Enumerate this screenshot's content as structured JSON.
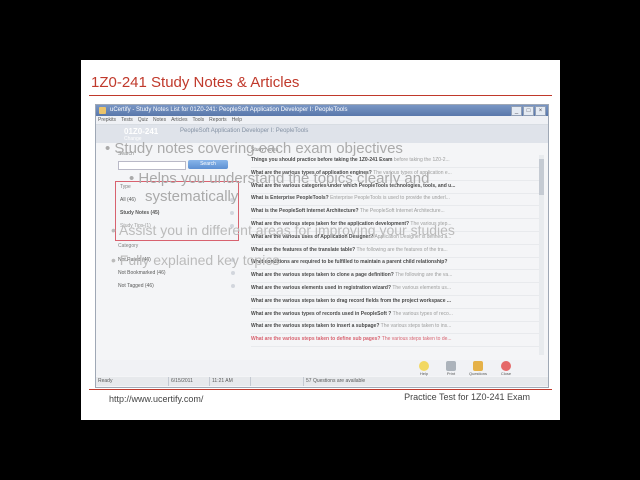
{
  "slide": {
    "title": "1Z0-241 Study Notes & Articles",
    "bullets": [
      "Study notes covering each exam objectives",
      "Helps you understand the topics clearly and",
      "systematically",
      "Assist you in different areas for improving your studies",
      "Fully explained key topics"
    ],
    "footer_url": "http://www.ucertify.com/",
    "footer_right": "Practice Test for 1Z0-241 Exam"
  },
  "window": {
    "title": "uCertify - Study Notes List for 01Z0-241: PeopleSoft Application Developer I: PeopleTools",
    "menu": [
      "Prepkits",
      "Tests",
      "Quiz",
      "Notes",
      "Articles",
      "Tools",
      "Reports",
      "Help"
    ],
    "exam_code": "01Z0-241",
    "exam_sub": "Change",
    "exam_name": "PeopleSoft Application Developer I: PeopleTools",
    "search_label": "Search",
    "search_button": "Search",
    "type_label": "Type",
    "types": [
      "All (46)",
      "Study Notes (45)",
      "Study Tips (1)"
    ],
    "category_label": "Category",
    "categories": [
      "Not Rated (46)",
      "Not Bookmarked (46)",
      "Not Tagged (46)"
    ],
    "notes_label": "Study Notes",
    "questions": [
      {
        "q": "Things you should practice before taking the 1Z0-241 Exam",
        "a": "before taking the 1Z0-2..."
      },
      {
        "q": "What are the various types of application engines?",
        "a": "The various types of application e..."
      },
      {
        "q": "What are the various categories under which PeopleTools technologies, tools, and u...",
        "a": ""
      },
      {
        "q": "What is Enterprise PeopleTools?",
        "a": "Enterprise PeopleTools is used to provide the underl..."
      },
      {
        "q": "What is the PeopleSoft Internet Architecture?",
        "a": "The PeopleSoft Internet Architecture..."
      },
      {
        "q": "What are the various steps taken for the application development?",
        "a": "The various step..."
      },
      {
        "q": "What are the various uses of Application Designer?",
        "a": "Application Designer is defined a..."
      },
      {
        "q": "What are the features of the translate table?",
        "a": "The following are the features of the tra..."
      },
      {
        "q": "What conditions are required to be fulfilled to maintain a parent child relationship?",
        "a": ""
      },
      {
        "q": "What are the various steps taken to clone a page definition?",
        "a": "The following are the va..."
      },
      {
        "q": "What are the various elements used in registration wizard?",
        "a": "The various elements us..."
      },
      {
        "q": "What are the various steps taken to drag record fields from the project workspace ...",
        "a": ""
      },
      {
        "q": "What are the various types of records used in PeopleSoft ?",
        "a": "The various types of reco..."
      },
      {
        "q": "What are the various steps taken to insert a subpage?",
        "a": "The various steps taken to ins..."
      },
      {
        "q": "What are the various steps taken to define sub pages?",
        "a": "The various steps taken to de..."
      }
    ],
    "buttons": [
      "Help",
      "Print",
      "Questions",
      "Close"
    ],
    "status": [
      "Ready",
      "6/15/2011",
      "11:21 AM",
      "",
      "57 Questions are available"
    ]
  },
  "colors": {
    "accent": "#c0392b",
    "titlebar": "#355a99",
    "highlight": "#d04050"
  }
}
